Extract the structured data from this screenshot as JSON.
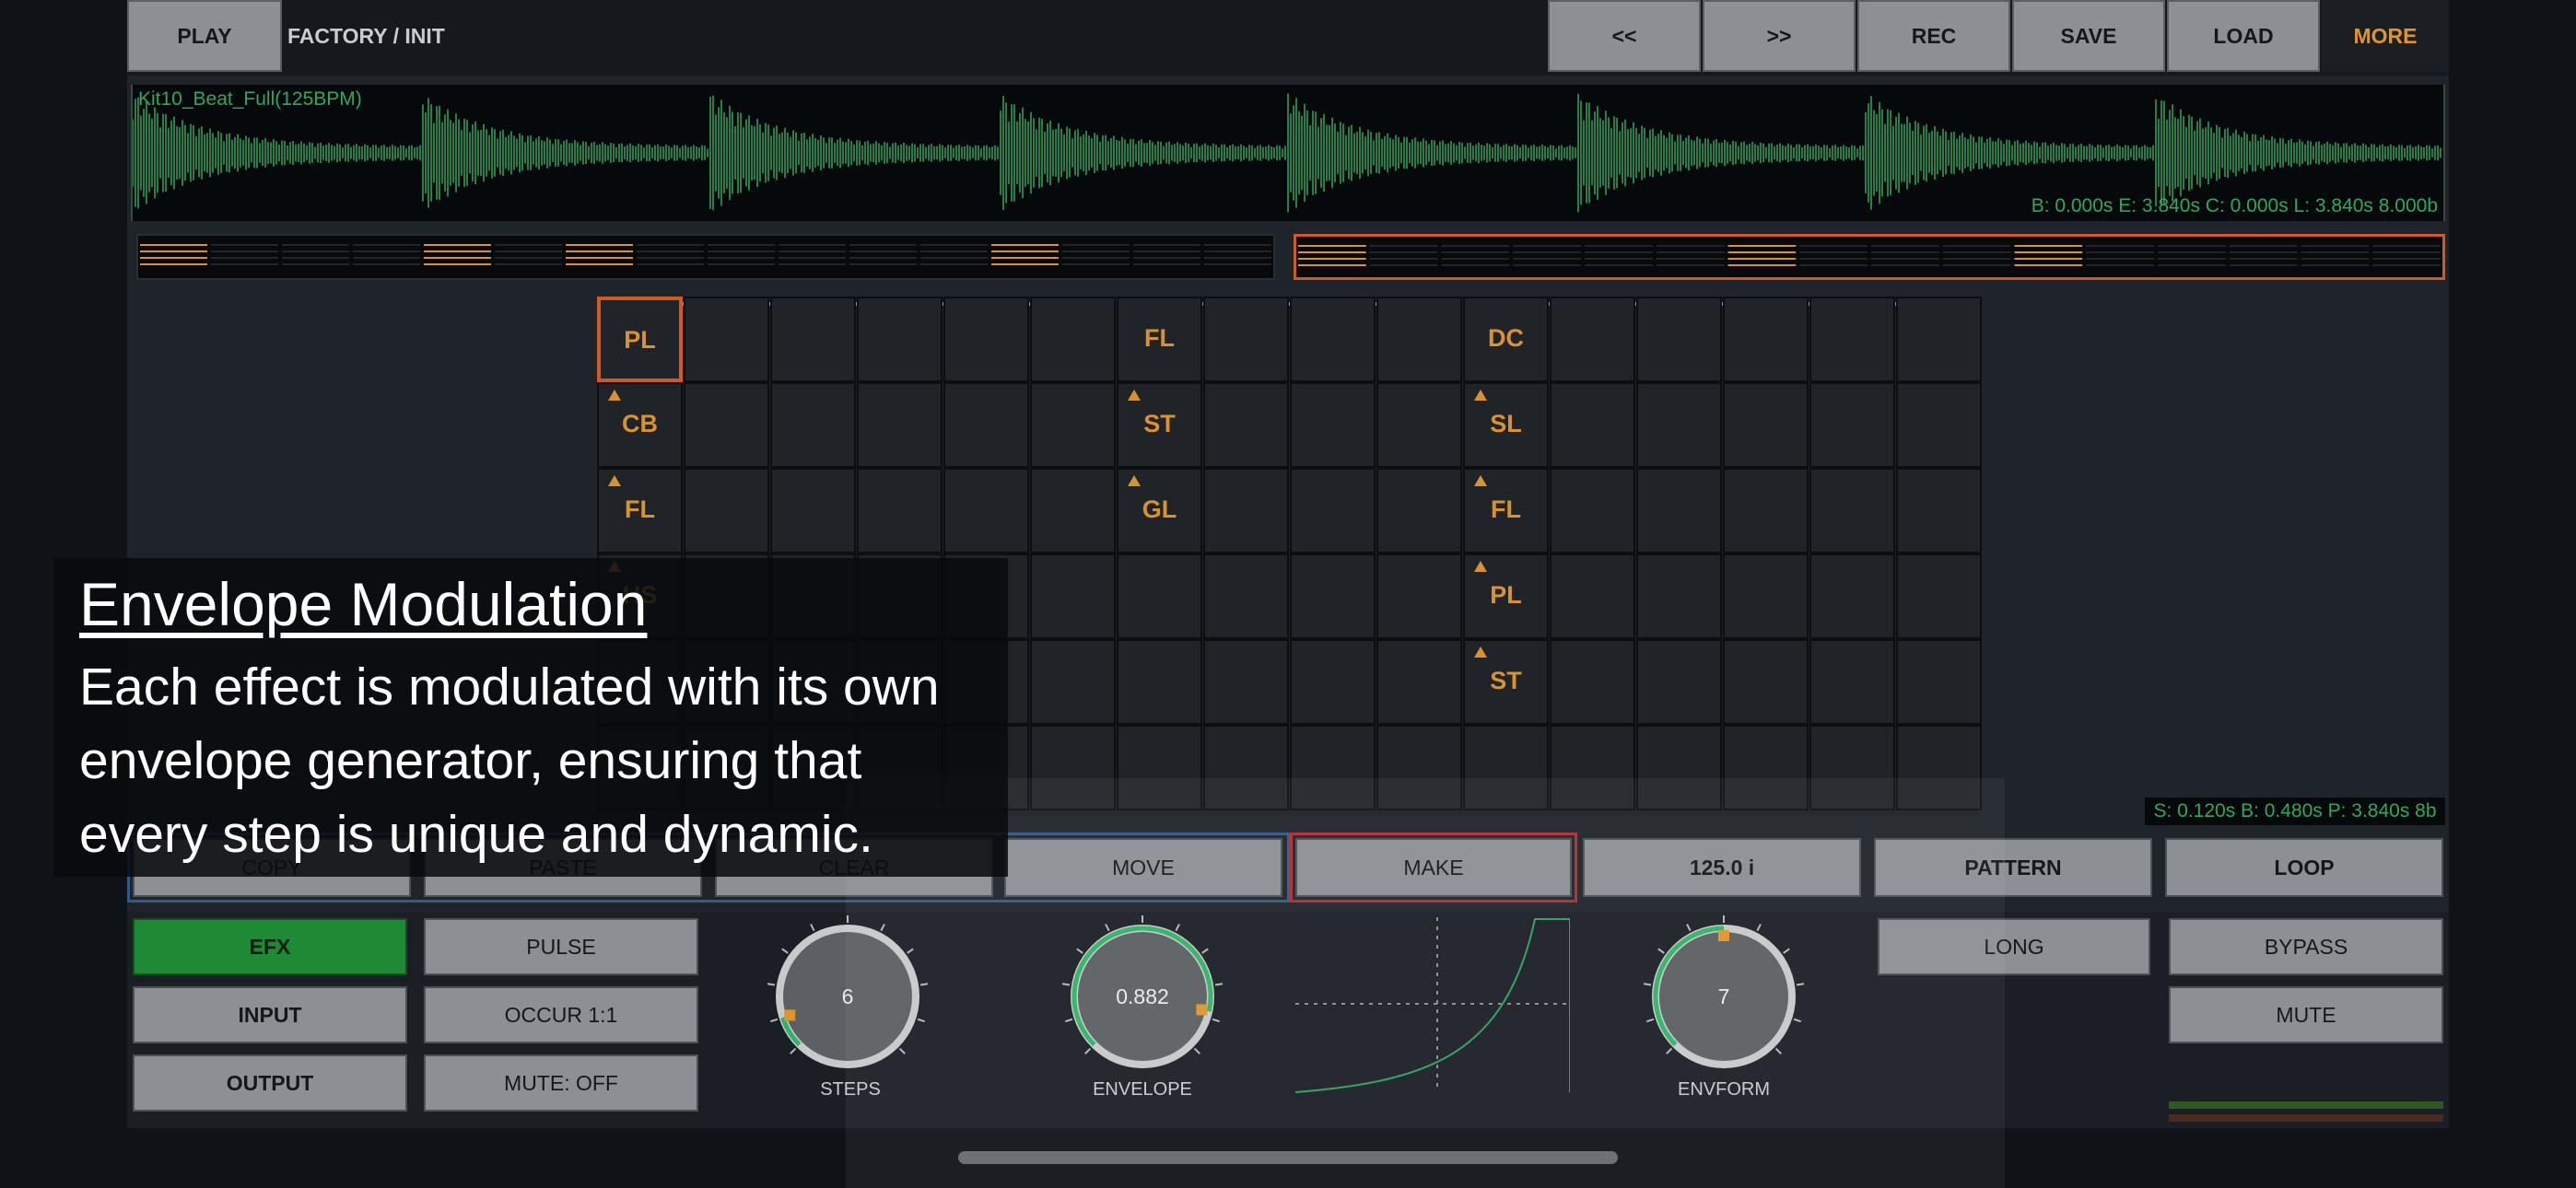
{
  "topbar": {
    "play": "PLAY",
    "preset": "FACTORY / INIT",
    "rewind": "<<",
    "forward": ">>",
    "rec": "REC",
    "save": "SAVE",
    "load": "LOAD",
    "more": "MORE"
  },
  "waveform": {
    "name": "Kit10_Beat_Full(125BPM)",
    "info": "B: 0.000s E: 3.840s C: 0.000s L: 3.840s 8.000b",
    "color": "#2ea85f"
  },
  "grid": {
    "columns": [
      {
        "cells": [
          "PL",
          "CB",
          "FL",
          "HS"
        ]
      },
      {
        "cells": [
          "FL",
          "ST",
          "GL"
        ]
      },
      {
        "cells": [
          "DC",
          "SL",
          "FL",
          "PL",
          "ST"
        ]
      }
    ],
    "selected_color": "#d25a22",
    "label_color": "#d99230"
  },
  "selection_info": "S: 0.120s B: 0.480s P: 3.840s 8b",
  "edit_row": {
    "copy": "COPY",
    "paste": "PASTE",
    "clear": "CLEAR",
    "move": "MOVE",
    "make": "MAKE",
    "tempo": "125.0 i",
    "pattern": "PATTERN",
    "loop": "LOOP"
  },
  "left_buttons": {
    "efx": "EFX",
    "input": "INPUT",
    "output": "OUTPUT",
    "pulse": "PULSE",
    "occur": "OCCUR 1:1",
    "mute_off": "MUTE: OFF"
  },
  "knobs": [
    {
      "label": "STEPS",
      "value": "6",
      "level": 0.1
    },
    {
      "label": "ENVELOPE",
      "value": "0.882",
      "level": 0.88
    },
    {
      "label": "ENVFORM",
      "value": "7",
      "level": 0.5
    }
  ],
  "right_buttons": {
    "long": "LONG",
    "bypass": "BYPASS",
    "mute": "MUTE"
  },
  "overlay": {
    "title": "Envelope Modulation",
    "body": "Each effect is modulated with its own envelope generator, ensuring that every step is unique and dynamic."
  }
}
